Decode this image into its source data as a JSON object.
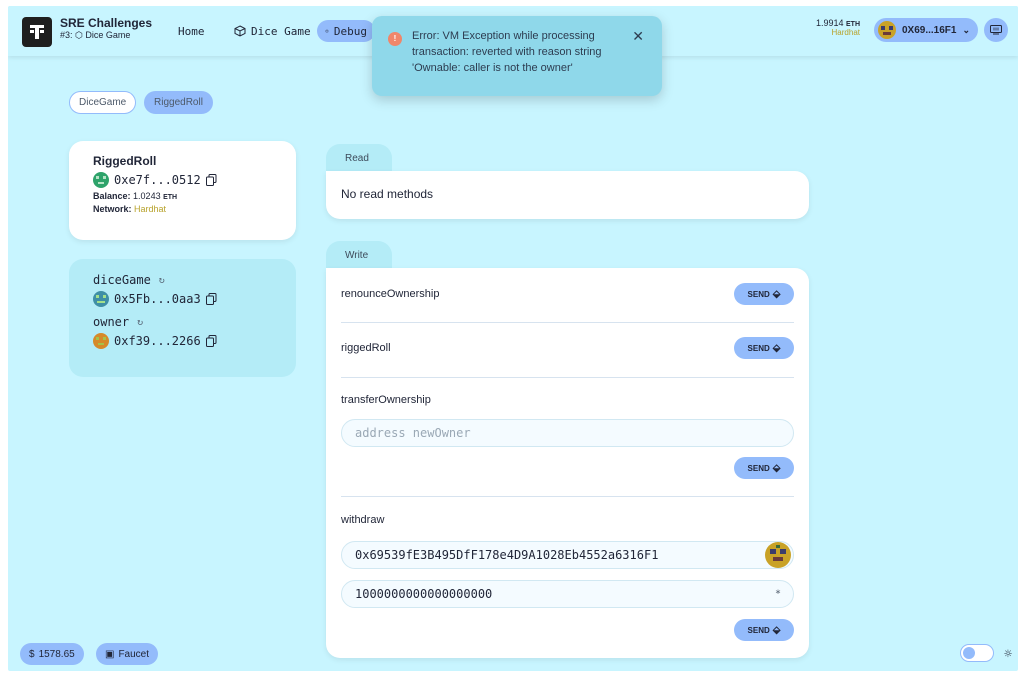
{
  "header": {
    "brand_title": "SRE Challenges",
    "brand_sub": "#3: ⬡ Dice Game",
    "nav": [
      {
        "label": "Home"
      },
      {
        "label": "Dice Game"
      },
      {
        "label": "Debug"
      }
    ],
    "eth_balance": "1.9914",
    "eth_unit": "ETH",
    "network": "Hardhat",
    "account": "0X69...16F1"
  },
  "toast": {
    "message": "Error: VM Exception while processing transaction: reverted with reason string 'Ownable: caller is not the owner'"
  },
  "contract_tabs": [
    {
      "label": "DiceGame"
    },
    {
      "label": "RiggedRoll"
    }
  ],
  "contract_info": {
    "name": "RiggedRoll",
    "address": "0xe7f...0512",
    "balance_label": "Balance:",
    "balance_value": "1.0243",
    "balance_unit": "ETH",
    "network_label": "Network:",
    "network_value": "Hardhat"
  },
  "variables": [
    {
      "name": "diceGame",
      "address": "0x5Fb...0aa3"
    },
    {
      "name": "owner",
      "address": "0xf39...2266"
    }
  ],
  "read": {
    "tab_label": "Read",
    "empty_text": "No read methods"
  },
  "write": {
    "tab_label": "Write",
    "send_label": "SEND",
    "methods": {
      "renounce": "renounceOwnership",
      "rigged": "riggedRoll",
      "transfer": "transferOwnership",
      "transfer_placeholder": "address newOwner",
      "withdraw": "withdraw",
      "withdraw_address": "0x69539fE3B495DfF178e4D9A1028Eb4552a6316F1",
      "withdraw_amount": "1000000000000000000",
      "amount_suffix": "*"
    }
  },
  "footer": {
    "price": "1578.65",
    "faucet": "Faucet"
  }
}
